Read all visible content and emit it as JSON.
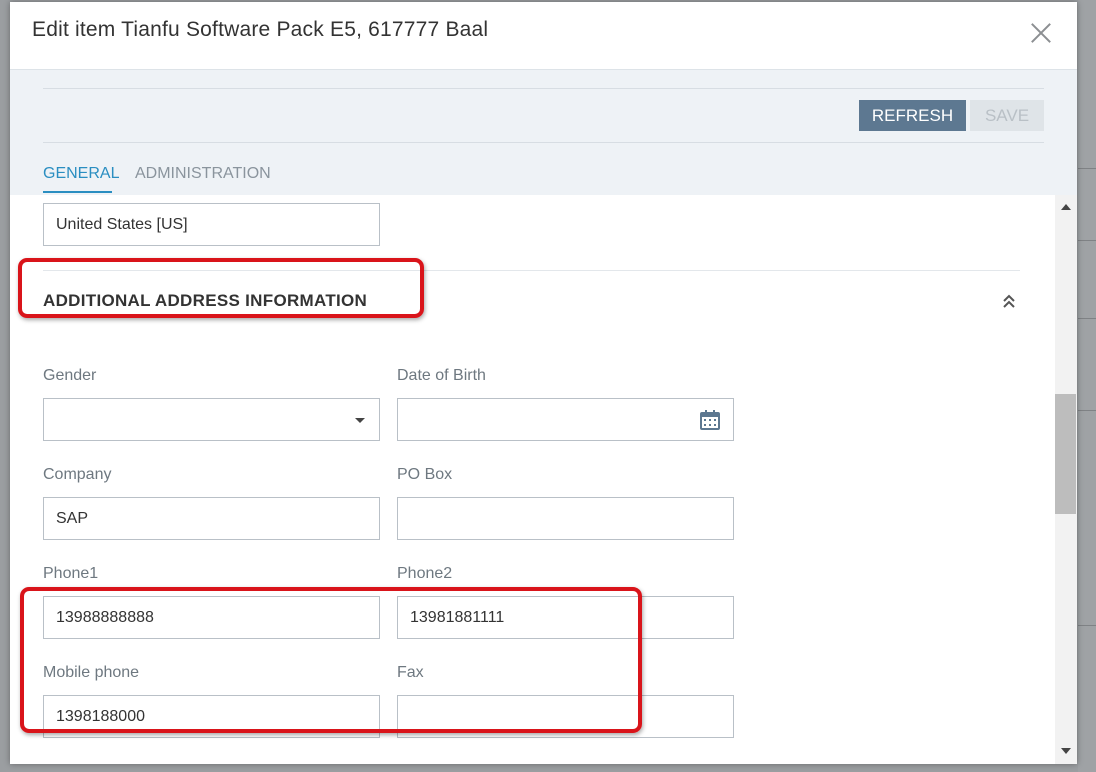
{
  "dialog": {
    "title": "Edit item Tianfu Software Pack E5, 617777 Baal"
  },
  "toolbar": {
    "refresh_label": "REFRESH",
    "save_label": "SAVE"
  },
  "tabs": [
    {
      "label": "GENERAL",
      "active": true
    },
    {
      "label": "ADMINISTRATION",
      "active": false
    }
  ],
  "form": {
    "country_value": "United States [US]",
    "section_title": "ADDITIONAL ADDRESS INFORMATION",
    "gender": {
      "label": "Gender",
      "value": ""
    },
    "date_of_birth": {
      "label": "Date of Birth",
      "value": ""
    },
    "company": {
      "label": "Company",
      "value": "SAP"
    },
    "po_box": {
      "label": "PO Box",
      "value": ""
    },
    "phone1": {
      "label": "Phone1",
      "value": "13988888888"
    },
    "phone2": {
      "label": "Phone2",
      "value": "13981881111"
    },
    "mobile_phone": {
      "label": "Mobile phone",
      "value": "1398188000"
    },
    "fax": {
      "label": "Fax",
      "value": ""
    }
  },
  "colors": {
    "accent": "#2a8ec1",
    "refresh_button": "#5d7891",
    "highlight": "#d9141a"
  }
}
